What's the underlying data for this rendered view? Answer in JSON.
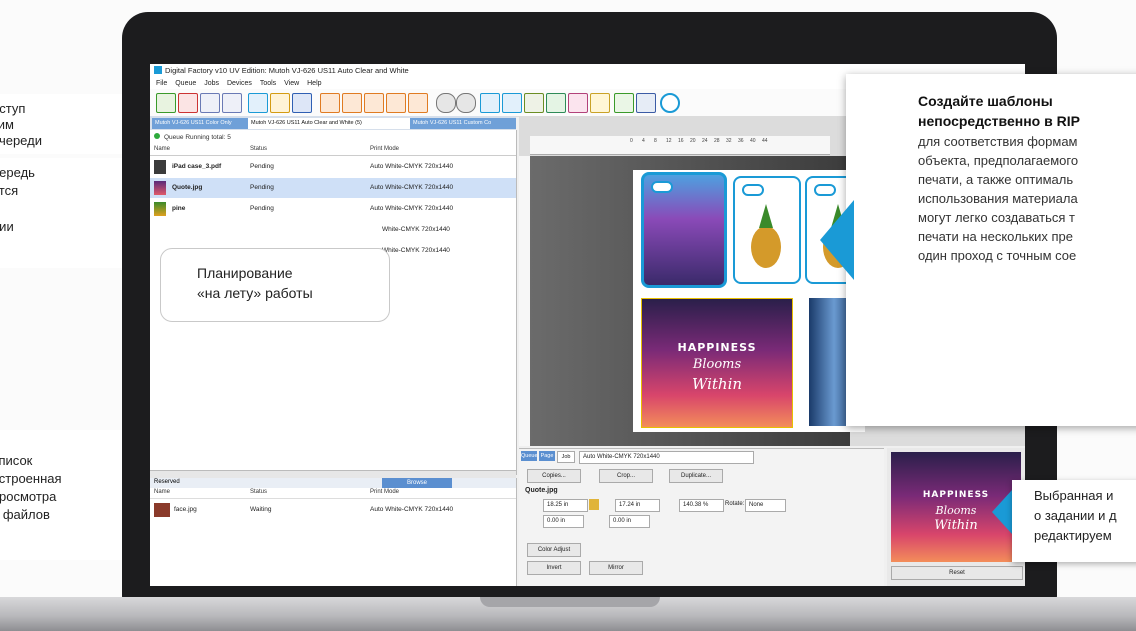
{
  "left_callouts": [
    {
      "lines": [
        "оступ",
        "ким",
        "очереди"
      ]
    },
    {
      "lines": [
        "нередь",
        "ется",
        "е",
        "нии"
      ]
    },
    {
      "lines": [
        "список",
        "встроенная",
        "просмотра",
        "а файлов"
      ]
    }
  ],
  "app": {
    "title": "Digital Factory v10 UV Edition: Mutoh VJ-626 US11 Auto Clear and White",
    "menu": [
      "File",
      "Queue",
      "Jobs",
      "Devices",
      "Tools",
      "View",
      "Help"
    ],
    "tabs": [
      "Mutoh VJ-626 US11 Color Only",
      "Mutoh VJ-626 US11 Auto Clear and White (5)",
      "Mutoh VJ-626 US11 Custom Co"
    ],
    "queue_status": "Queue Running   total: 5",
    "columns": {
      "name": "Name",
      "status": "Status",
      "mode": "Print Mode"
    },
    "jobs": [
      {
        "name": "iPad case_3.pdf",
        "status": "Pending",
        "mode": "Auto White-CMYK 720x1440"
      },
      {
        "name": "Quote.jpg",
        "status": "Pending",
        "mode": "Auto White-CMYK 720x1440"
      },
      {
        "name": "pine",
        "status": "Pending",
        "mode": "Auto White-CMYK 720x1440"
      },
      {
        "name": "",
        "status": "",
        "mode": "White-CMYK 720x1440"
      },
      {
        "name": "",
        "status": "",
        "mode": "White-CMYK 720x1440"
      }
    ],
    "reserved": {
      "tab_reserved": "Reserved",
      "tab_browse": "Browse",
      "columns": {
        "name": "Name",
        "status": "Status",
        "mode": "Print Mode"
      },
      "rows": [
        {
          "name": "face.jpg",
          "status": "Waiting",
          "mode": "Auto White-CMYK 720x1440"
        }
      ]
    },
    "ruler_ticks": [
      "0",
      "4",
      "8",
      "12",
      "16",
      "20",
      "24",
      "28",
      "32",
      "36",
      "40",
      "44"
    ],
    "job_panel": {
      "tabs": [
        "Queue",
        "Page",
        "Job"
      ],
      "mode_select": "Auto White-CMYK 720x1440",
      "copies": "Copies...",
      "crop": "Crop...",
      "duplicate": "Duplicate...",
      "filename": "Quote.jpg",
      "width": "18.25 in",
      "height": "17.24 in",
      "scale": "140.38 %",
      "rotate_label": "Rotate:",
      "rotate_value": "None",
      "x": "0.00 in",
      "y": "0.00 in",
      "color_adjust": "Color Adjust",
      "invert": "Invert",
      "mirror": "Mirror",
      "reset": "Reset"
    },
    "artwork": {
      "line1": "HAPPINESS",
      "line2": "Blooms",
      "line3": "Within"
    }
  },
  "bubble": {
    "line1": "Планирование",
    "line2": "«на лету» работы"
  },
  "callout": {
    "title1": "Создайте шаблоны",
    "title2": "непосредственно в RIP",
    "lines": [
      "для соответствия формам",
      "объекта, предполагаемого",
      "печати, а также оптималь",
      "использования материала",
      "могут легко создаваться т",
      "печати на нескольких пре",
      "один проход с точным сое"
    ]
  },
  "bottom_callout": {
    "lines": [
      "Выбранная и",
      "о задании и д",
      "редактируем"
    ]
  },
  "colors": {
    "accent": "#1a9ad6"
  }
}
